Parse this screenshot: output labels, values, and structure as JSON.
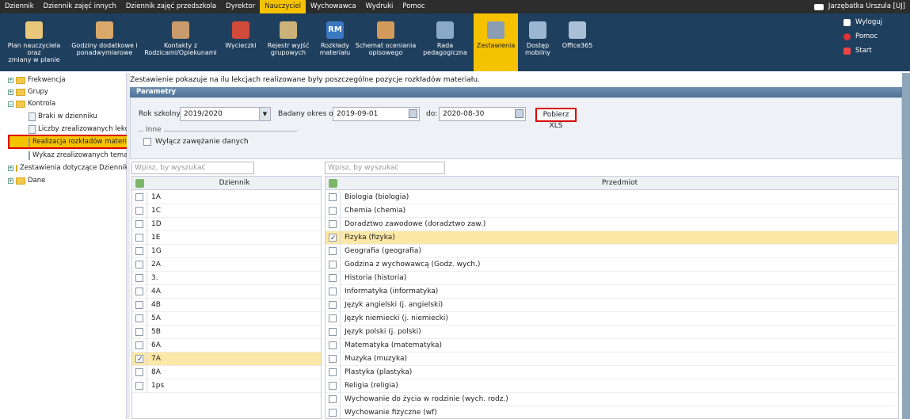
{
  "topmenu": {
    "items": [
      "Dziennik",
      "Dziennik zajęć innych",
      "Dziennik zajęć przedszkola",
      "Dyrektor",
      "Nauczyciel",
      "Wychowawca",
      "Wydruki",
      "Pomoc"
    ],
    "active_index": 4,
    "user": "Jarzębatka Urszula [UJ]"
  },
  "ribbon": {
    "buttons": [
      {
        "label": "Plan nauczyciela oraz\nzmiany w planie",
        "icon": "calendar-icon"
      },
      {
        "label": "Godziny dodatkowe i\nponadwymiarowe",
        "icon": "people-icon"
      },
      {
        "label": "Kontakty z\nRodzicami/Opiekunami",
        "icon": "contacts-icon"
      },
      {
        "label": "Wycieczki",
        "icon": "backpack-icon"
      },
      {
        "label": "Rejestr wyjść\ngrupowych",
        "icon": "group-exit-icon"
      },
      {
        "label": "Rozkłady\nmateriału",
        "icon": "rm-icon"
      },
      {
        "label": "Schemat oceniania\nopisowego",
        "icon": "grading-icon"
      },
      {
        "label": "Rada\npedagogiczna",
        "icon": "council-icon"
      },
      {
        "label": "Zestawienia",
        "icon": "reports-icon"
      },
      {
        "label": "Dostęp\nmobilny",
        "icon": "mobile-icon"
      },
      {
        "label": "Office365",
        "icon": "office-icon"
      }
    ],
    "active_index": 8,
    "right": {
      "logout": "Wyloguj",
      "help": "Pomoc",
      "start": "Start"
    }
  },
  "tree": {
    "items": [
      {
        "label": "Frekwencja",
        "type": "folder",
        "level": 0
      },
      {
        "label": "Grupy",
        "type": "folder",
        "level": 0
      },
      {
        "label": "Kontrola",
        "type": "folder-open",
        "level": 0
      },
      {
        "label": "Braki w dzienniku",
        "type": "doc",
        "level": 1
      },
      {
        "label": "Liczby zrealizowanych lekcji",
        "type": "doc",
        "level": 1
      },
      {
        "label": "Realizacja rozkładów materiału",
        "type": "doc",
        "level": 1,
        "selected": true
      },
      {
        "label": "Wykaz zrealizowanych tematów",
        "type": "doc",
        "level": 1
      },
      {
        "label": "Zestawienia dotyczące Dzienników",
        "type": "folder",
        "level": 0
      },
      {
        "label": "Dane",
        "type": "folder",
        "level": 0
      }
    ]
  },
  "main": {
    "description": "Zestawienie pokazuje na ilu lekcjach realizowane były poszczególne pozycje rozkładów materiału.",
    "params_title": "Parametry",
    "year_label": "Rok szkolny:",
    "year_value": "2019/2020",
    "from_label": "Badany okres od:",
    "from_value": "2019-09-01",
    "to_label": "do:",
    "to_value": "2020-08-30",
    "xls_button": "Pobierz XLS",
    "other_legend": "Inne",
    "narrowing_label": "Wyłącz zawężanie danych",
    "search_placeholder_left": "Wpisz, by wyszukać",
    "search_placeholder_right": "Wpisz, by wyszukać",
    "left_header": "Dziennik",
    "right_header": "Przedmiot",
    "journals": [
      {
        "name": "1A",
        "checked": false
      },
      {
        "name": "1C",
        "checked": false
      },
      {
        "name": "1D",
        "checked": false
      },
      {
        "name": "1E",
        "checked": false
      },
      {
        "name": "1G",
        "checked": false
      },
      {
        "name": "2A",
        "checked": false
      },
      {
        "name": "3.",
        "checked": false
      },
      {
        "name": "4A",
        "checked": false
      },
      {
        "name": "4B",
        "checked": false
      },
      {
        "name": "5A",
        "checked": false
      },
      {
        "name": "5B",
        "checked": false
      },
      {
        "name": "6A",
        "checked": false
      },
      {
        "name": "7A",
        "checked": true
      },
      {
        "name": "8A",
        "checked": false
      },
      {
        "name": "1ps",
        "checked": false
      }
    ],
    "subjects": [
      {
        "name": "Biologia (biologia)",
        "checked": false
      },
      {
        "name": "Chemia (chemia)",
        "checked": false
      },
      {
        "name": "Doradztwo zawodowe (doradztwo zaw.)",
        "checked": false
      },
      {
        "name": "Fizyka (fizyka)",
        "checked": true
      },
      {
        "name": "Geografia (geografia)",
        "checked": false
      },
      {
        "name": "Godzina z wychowawcą (Godz. wych.)",
        "checked": false
      },
      {
        "name": "Historia (historia)",
        "checked": false
      },
      {
        "name": "Informatyka (informatyka)",
        "checked": false
      },
      {
        "name": "Język angielski (j. angielski)",
        "checked": false
      },
      {
        "name": "Język niemiecki (j. niemiecki)",
        "checked": false
      },
      {
        "name": "Język polski (j. polski)",
        "checked": false
      },
      {
        "name": "Matematyka (matematyka)",
        "checked": false
      },
      {
        "name": "Muzyka (muzyka)",
        "checked": false
      },
      {
        "name": "Plastyka (plastyka)",
        "checked": false
      },
      {
        "name": "Religia (religia)",
        "checked": false
      },
      {
        "name": "Wychowanie do życia w rodzinie (wych. rodz.)",
        "checked": false
      },
      {
        "name": "Wychowanie fizyczne (wf)",
        "checked": false
      }
    ]
  },
  "colors": {
    "accent": "#f5c200",
    "ribbon": "#1f3f5e",
    "topbar": "#2d2d2d",
    "highlight": "#d00000"
  }
}
